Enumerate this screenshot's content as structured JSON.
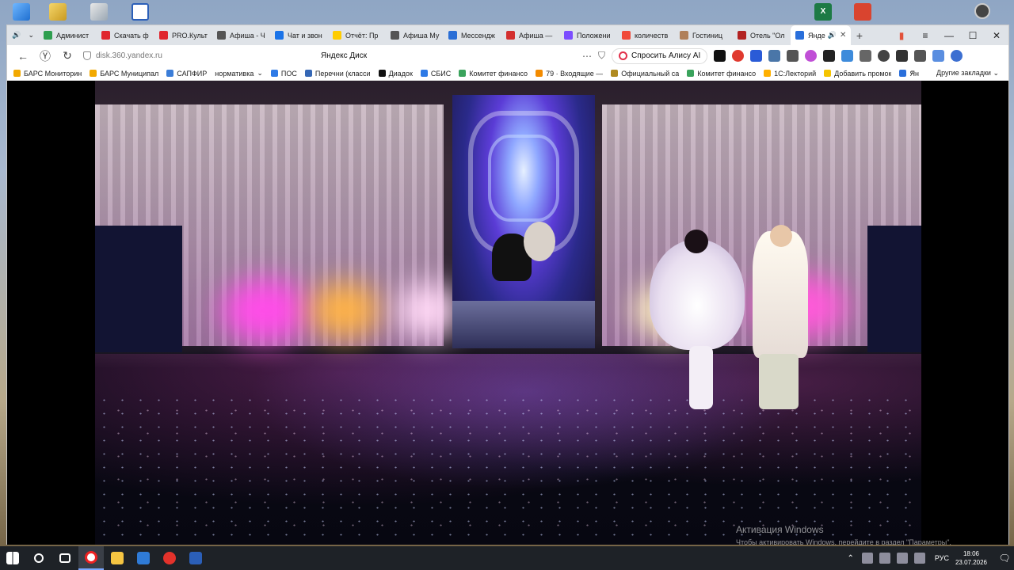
{
  "browser": {
    "tabs": [
      {
        "label": "Админист",
        "color": "#2e9e4f"
      },
      {
        "label": "Скачать ф",
        "color": "#e0262e"
      },
      {
        "label": "PRO.Культ",
        "color": "#e0262e"
      },
      {
        "label": "Афиша - Ч",
        "color": "#555555"
      },
      {
        "label": "Чат и звон",
        "color": "#1a73e8"
      },
      {
        "label": "Отчёт: Пр",
        "color": "#ffcc00"
      },
      {
        "label": "Афиша Му",
        "color": "#555555"
      },
      {
        "label": "Мессендж",
        "color": "#2b6fd6"
      },
      {
        "label": "Афиша —",
        "color": "#d32f2f"
      },
      {
        "label": "Положени",
        "color": "#7c4dff"
      },
      {
        "label": "количеств",
        "color": "#f04a3a"
      },
      {
        "label": "Гостиниц",
        "color": "#b0805a"
      },
      {
        "label": "Отель \"Ол",
        "color": "#b22222"
      }
    ],
    "active_tab": {
      "label": "Янде",
      "color": "#2a6fdb"
    },
    "new_tab_label": "+",
    "window_controls": {
      "minimize": "—",
      "maximize": "☐",
      "close": "✕",
      "menu": "≡"
    },
    "url": "disk.360.yandex.ru",
    "page_title": "Яндекс Диск",
    "alice_label": "Спросить Алису AI",
    "bookmarks": [
      {
        "label": "БАРС Мониторин",
        "color": "#f2a900"
      },
      {
        "label": "БАРС Муниципал",
        "color": "#f2a900"
      },
      {
        "label": "САПФИР",
        "color": "#3b7dd8"
      },
      {
        "label": "нормативка",
        "color": "#777777"
      },
      {
        "label": "ПОС",
        "color": "#2e7ae6"
      },
      {
        "label": "Перечни (класси",
        "color": "#3567b5"
      },
      {
        "label": "Диадок",
        "color": "#111111"
      },
      {
        "label": "СБИС",
        "color": "#2e7ae6"
      },
      {
        "label": "Комитет финансо",
        "color": "#3aa35c"
      },
      {
        "label": "79 · Входящие — ",
        "color": "#f38b00"
      },
      {
        "label": "Официальный са",
        "color": "#b08a20"
      },
      {
        "label": "Комитет финансо",
        "color": "#3aa35c"
      },
      {
        "label": "1С:Лекторий",
        "color": "#ffb000"
      },
      {
        "label": "Добавить промок",
        "color": "#f5c400"
      },
      {
        "label": "Ян",
        "color": "#2a6fdb"
      }
    ],
    "bookmarks_more": "»",
    "bookmarks_other": "Другие закладки"
  },
  "overlay": {
    "activation_title": "Активация Windows",
    "activation_text": "Чтобы активировать Windows, перейдите в раздел \"Параметры\"."
  },
  "taskbar": {
    "language": "РУС",
    "time": "18:06",
    "date": "23.07.2026"
  }
}
